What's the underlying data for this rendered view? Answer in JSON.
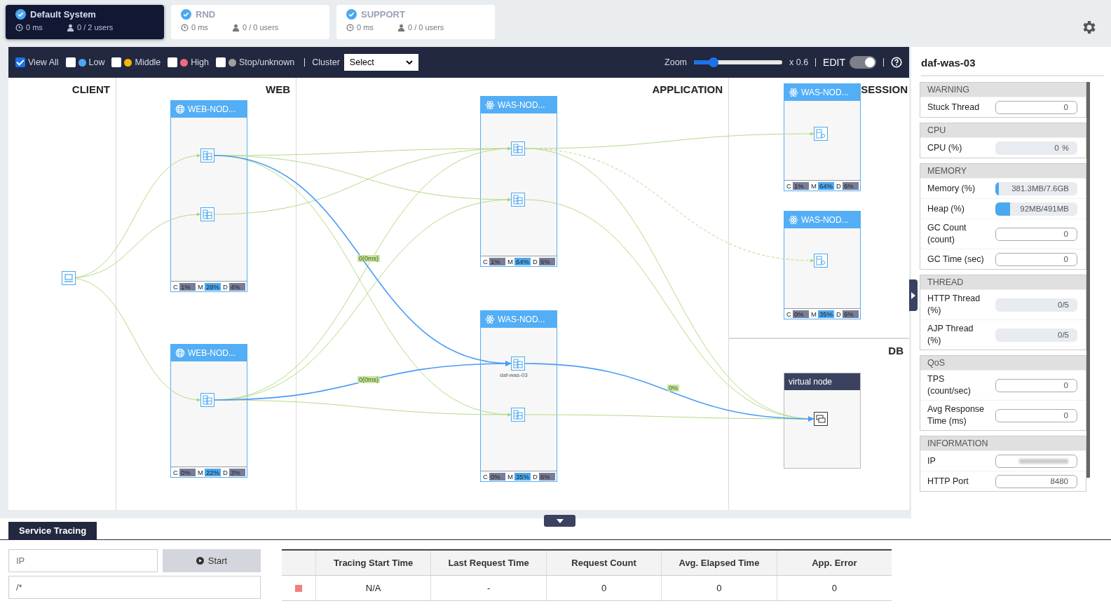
{
  "systems": [
    {
      "name": "Default System",
      "response": "0 ms",
      "users": "0 / 2 users",
      "selected": true
    },
    {
      "name": "RND",
      "response": "0 ms",
      "users": "0 / 0 users",
      "selected": false
    },
    {
      "name": "SUPPORT",
      "response": "0 ms",
      "users": "0 / 0 users",
      "selected": false
    }
  ],
  "toolbar": {
    "view_all": {
      "label": "View All",
      "checked": true
    },
    "filters": [
      {
        "label": "Low",
        "checked": false,
        "color": "#4aa8f0"
      },
      {
        "label": "Middle",
        "checked": false,
        "color": "#f5b800"
      },
      {
        "label": "High",
        "checked": false,
        "color": "#f06a7e"
      },
      {
        "label": "Stop/unknown",
        "checked": false,
        "color": "#a0a0a0"
      }
    ],
    "cluster_label": "Cluster",
    "cluster_select": "Select",
    "zoom_label": "Zoom",
    "zoom": {
      "level": 0.22
    },
    "zoom_value": "x 0.6",
    "edit_label": "EDIT",
    "edit_on": true
  },
  "topology": {
    "columns": [
      "CLIENT",
      "WEB",
      "APPLICATION",
      "SESSION",
      "DB"
    ],
    "nodes": [
      {
        "kind": "web",
        "title": "WEB-NOD...",
        "metrics": [
          {
            "kind": "cpu",
            "label": "C",
            "value": "1%"
          },
          {
            "kind": "memory",
            "label": "M",
            "value": "28%"
          },
          {
            "kind": "disk",
            "label": "D",
            "value": "4%"
          }
        ],
        "instances": [
          {
            "kind": "server"
          },
          {
            "kind": "server"
          }
        ]
      },
      {
        "kind": "web",
        "title": "WEB-NOD...",
        "metrics": [
          {
            "kind": "cpu",
            "label": "C",
            "value": "0%"
          },
          {
            "kind": "memory",
            "label": "M",
            "value": "22%"
          },
          {
            "kind": "disk",
            "label": "D",
            "value": "3%"
          }
        ],
        "instances": [
          {
            "kind": "server"
          }
        ]
      },
      {
        "kind": "was",
        "title": "WAS-NOD...",
        "metrics": [
          {
            "kind": "cpu",
            "label": "C",
            "value": "1%"
          },
          {
            "kind": "memory",
            "label": "M",
            "value": "64%"
          },
          {
            "kind": "disk",
            "label": "D",
            "value": "6%"
          }
        ],
        "instances": [
          {
            "kind": "server"
          },
          {
            "kind": "server"
          }
        ]
      },
      {
        "kind": "was",
        "title": "WAS-NOD...",
        "metrics": [
          {
            "kind": "cpu",
            "label": "C",
            "value": "0%"
          },
          {
            "kind": "memory",
            "label": "M",
            "value": "35%"
          },
          {
            "kind": "disk",
            "label": "D",
            "value": "6%"
          }
        ],
        "instances": [
          {
            "kind": "server",
            "label": "daf-was-03"
          },
          {
            "kind": "server"
          }
        ]
      },
      {
        "kind": "was",
        "title": "WAS-NOD...",
        "metrics": [
          {
            "kind": "cpu",
            "label": "C",
            "value": "1%"
          },
          {
            "kind": "memory",
            "label": "M",
            "value": "64%"
          },
          {
            "kind": "disk",
            "label": "D",
            "value": "6%"
          }
        ],
        "instances": [
          {
            "kind": "session"
          }
        ]
      },
      {
        "kind": "was",
        "title": "WAS-NOD...",
        "metrics": [
          {
            "kind": "cpu",
            "label": "C",
            "value": "0%"
          },
          {
            "kind": "memory",
            "label": "M",
            "value": "35%"
          },
          {
            "kind": "disk",
            "label": "D",
            "value": "6%"
          }
        ],
        "instances": [
          {
            "kind": "session"
          }
        ]
      },
      {
        "kind": "virtual",
        "title": "virtual node",
        "instances": [
          {
            "kind": "db"
          }
        ]
      }
    ],
    "edge_labels": [
      "0(0ms)",
      "0(0ms)",
      "0%"
    ]
  },
  "panel": {
    "title": "daf-was-03",
    "sections": [
      {
        "title": "WARNING",
        "rows": [
          {
            "label": "Stuck Thread",
            "kind": "field",
            "value": "0"
          }
        ]
      },
      {
        "title": "CPU",
        "rows": [
          {
            "label": "CPU (%)",
            "kind": "gauge",
            "value": "0",
            "unit": "%"
          }
        ]
      },
      {
        "title": "MEMORY",
        "rows": [
          {
            "label": "Memory (%)",
            "kind": "gauge",
            "value": "381.3MB/7.6GB",
            "level": 0.04
          },
          {
            "label": "Heap (%)",
            "kind": "gauge",
            "value": "92MB/491MB",
            "level": 0.18
          },
          {
            "label": "GC Count (count)",
            "kind": "field",
            "value": "0"
          },
          {
            "label": "GC Time (sec)",
            "kind": "field",
            "value": "0"
          }
        ]
      },
      {
        "title": "THREAD",
        "rows": [
          {
            "label": "HTTP Thread (%)",
            "kind": "gauge",
            "value": "0/5"
          },
          {
            "label": "AJP Thread (%)",
            "kind": "gauge",
            "value": "0/5"
          }
        ]
      },
      {
        "title": "QoS",
        "rows": [
          {
            "label": "TPS (count/sec)",
            "kind": "field",
            "value": "0"
          },
          {
            "label": "Avg Response Time (ms)",
            "kind": "field",
            "value": "0"
          }
        ]
      },
      {
        "title": "INFORMATION",
        "rows": [
          {
            "label": "IP",
            "kind": "field",
            "redacted": true
          },
          {
            "label": "HTTP Port",
            "kind": "field",
            "value": "8480"
          }
        ]
      }
    ]
  },
  "tracing": {
    "tab": "Service Tracing",
    "ip_placeholder": "IP",
    "start_button": "Start",
    "path_value": "/*",
    "columns": [
      "Tracing Start Time",
      "Last Request Time",
      "Request Count",
      "Avg. Elapsed Time",
      "App. Error"
    ],
    "rows": [
      {
        "color": "#f08080",
        "cells": [
          "N/A",
          "-",
          "0",
          "0",
          "0"
        ]
      }
    ]
  }
}
